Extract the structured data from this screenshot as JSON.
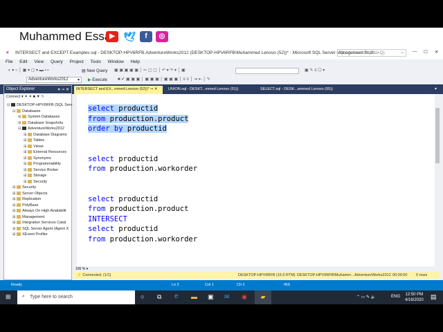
{
  "banner": {
    "name": "Muhammed Essa",
    "socials": [
      "youtube-icon",
      "twitter-icon",
      "facebook-icon",
      "instagram-icon"
    ]
  },
  "window": {
    "title": "INTERSECT and EXCEPT Examples.sql - DESKTOP-HPV6RFB.AdventureWorks2012 (DESKTOP-HPV6RFB\\Muhammed Lenovo (52))* - Microsoft SQL Server Management Studi...",
    "quick_launch": "Quick Launch (Ctrl+Q)"
  },
  "menu": [
    "File",
    "Edit",
    "View",
    "Query",
    "Project",
    "Tools",
    "Window",
    "Help"
  ],
  "toolbar": {
    "new_query": "New Query",
    "database": "AdventureWorks2012",
    "execute": "Execute"
  },
  "tabs": [
    "INTERSECT and EX...mmed Lenovo (52))*",
    "UNION.sql - DESKT...mmed Lenovo (51))",
    "SELECT.sql - DESK...ammed Lenovo (55))"
  ],
  "object_explorer": {
    "title": "Object Explorer",
    "connect": "Connect",
    "nodes": [
      {
        "label": "DESKTOP-HPV6RFB (SQL Serv",
        "level": 0
      },
      {
        "label": "Databases",
        "level": 1
      },
      {
        "label": "System Databases",
        "level": 2
      },
      {
        "label": "Database Snapshots",
        "level": 2
      },
      {
        "label": "AdventureWorks2012",
        "level": 2
      },
      {
        "label": "Database Diagrams",
        "level": 3
      },
      {
        "label": "Tables",
        "level": 3
      },
      {
        "label": "Views",
        "level": 3
      },
      {
        "label": "External Resources",
        "level": 3
      },
      {
        "label": "Synonyms",
        "level": 3
      },
      {
        "label": "Programmability",
        "level": 3
      },
      {
        "label": "Service Broker",
        "level": 3
      },
      {
        "label": "Storage",
        "level": 3
      },
      {
        "label": "Security",
        "level": 3
      },
      {
        "label": "Security",
        "level": 1
      },
      {
        "label": "Server Objects",
        "level": 1
      },
      {
        "label": "Replication",
        "level": 1
      },
      {
        "label": "PolyBase",
        "level": 1
      },
      {
        "label": "Always On High Availabilit",
        "level": 1
      },
      {
        "label": "Management",
        "level": 1
      },
      {
        "label": "Integration Services Catal",
        "level": 1
      },
      {
        "label": "SQL Server Agent (Agent X",
        "level": 1
      },
      {
        "label": "XEvent Profiler",
        "level": 1
      }
    ]
  },
  "editor": {
    "lines": [
      {
        "kw": "select",
        "rest": " productid",
        "sel": true,
        "row": 0
      },
      {
        "kw": "from",
        "rest": " production.product",
        "sel": true,
        "row": 1
      },
      {
        "kw": "order by",
        "rest": " productid",
        "sel": true,
        "row": 2
      },
      {
        "kw": "select",
        "rest": " productid",
        "row": 5
      },
      {
        "kw": "from",
        "rest": " production.workorder",
        "row": 6
      },
      {
        "kw": "select",
        "rest": " productid",
        "row": 9
      },
      {
        "kw": "from",
        "rest": " production.product",
        "row": 10
      },
      {
        "kw": "INTERSECT",
        "rest": "",
        "row": 11
      },
      {
        "kw": "select",
        "rest": " productid",
        "row": 12
      },
      {
        "kw": "from",
        "rest": " production.workorder",
        "row": 13
      }
    ],
    "zoom": "100 %"
  },
  "query_status": {
    "connected": "Connected. (1/1)",
    "server": "DESKTOP-HPV6RFB (15.0 RTM)",
    "user": "DESKTOP-HPV6RFB\\Muhamm...",
    "db": "AdventureWorks2012",
    "time": "00:00:00",
    "rows": "0 rows"
  },
  "status": {
    "ready": "Ready",
    "ln": "Ln 2",
    "col": "Col 1",
    "ch": "Ch 1",
    "ins": "INS"
  },
  "taskbar": {
    "search": "Type here to search",
    "lang": "ENG",
    "time": "12:50 PM",
    "date": "4/16/2020"
  }
}
